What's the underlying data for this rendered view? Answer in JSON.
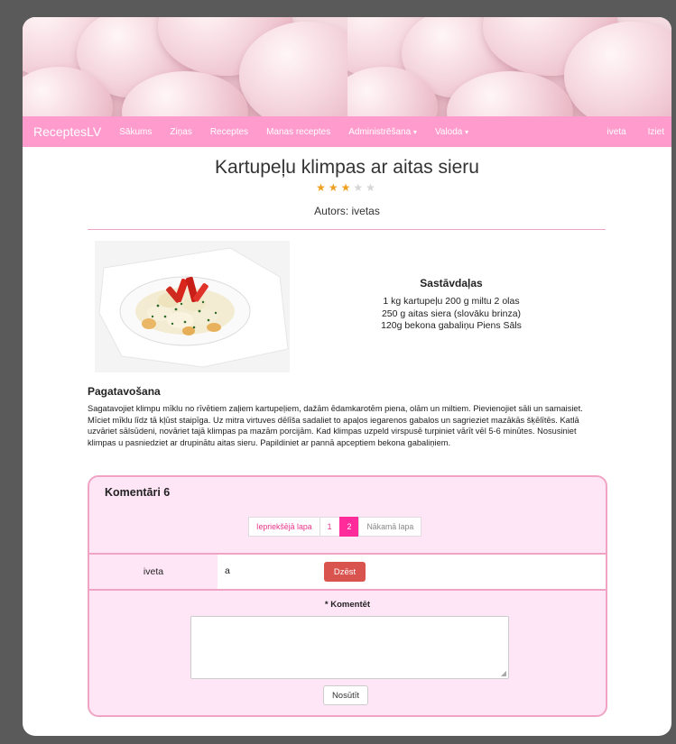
{
  "navbar": {
    "brand": "ReceptesLV",
    "items": [
      "Sākums",
      "Ziņas",
      "Receptes",
      "Manas receptes",
      "Administrēšana",
      "Valoda"
    ],
    "user": "iveta",
    "logout": "Iziet"
  },
  "recipe": {
    "title": "Kartupeļu klimpas ar aitas sieru",
    "rating": 3,
    "rating_max": 5,
    "author": "Autors: ivetas",
    "ingredients_heading": "Sastāvdaļas",
    "ingredients_lines": [
      "1 kg kartupeļu 200 g miltu 2 olas",
      "250 g aitas siera (slovāku brinza)",
      "120g bekona gabaliņu Piens Sāls"
    ],
    "preparation_heading": "Pagatavošana",
    "preparation_text": "Sagatavojiet klimpu mīklu no rīvētiem zaļiem kartupeļiem, dažām ēdamkarotēm piena, olām un miltiem. Pievienojiet sāli un samaisiet. Mīciet mīklu līdz tā kļūst staipīga. Uz mitra virtuves dēlīša sadaliet to apaļos iegarenos gabalos un sagrieziet mazākās šķēlītēs. Katlā uzvāriet sālsūdeni, novāriet tajā klimpas pa mazām porcijām. Kad klimpas uzpeld virspusē turpiniet vārīt vēl 5-6 minūtes. Nosusiniet klimpas u pasniedziet ar drupinātu aitas sieru. Papildiniet ar pannā apceptiem bekona gabaliņiem."
  },
  "comments": {
    "heading": "Komentāri 6",
    "pager": {
      "prev": "Iepriekšējā lapa",
      "pages": [
        "1",
        "2"
      ],
      "active": "2",
      "next": "Nākamā lapa"
    },
    "rows": [
      {
        "user": "iveta",
        "text": "a",
        "delete_label": "Dzēst"
      }
    ],
    "form": {
      "required_mark": "*",
      "label": "Komentēt",
      "textarea_value": "",
      "submit_label": "Nosūtīt"
    }
  },
  "colors": {
    "navbar": "#ff9ccd",
    "accent": "#ff2b9b",
    "panel_bg": "#ffe6f7",
    "panel_border": "#f0a4c4",
    "delete": "#d9534f",
    "star": "#f0a020"
  }
}
